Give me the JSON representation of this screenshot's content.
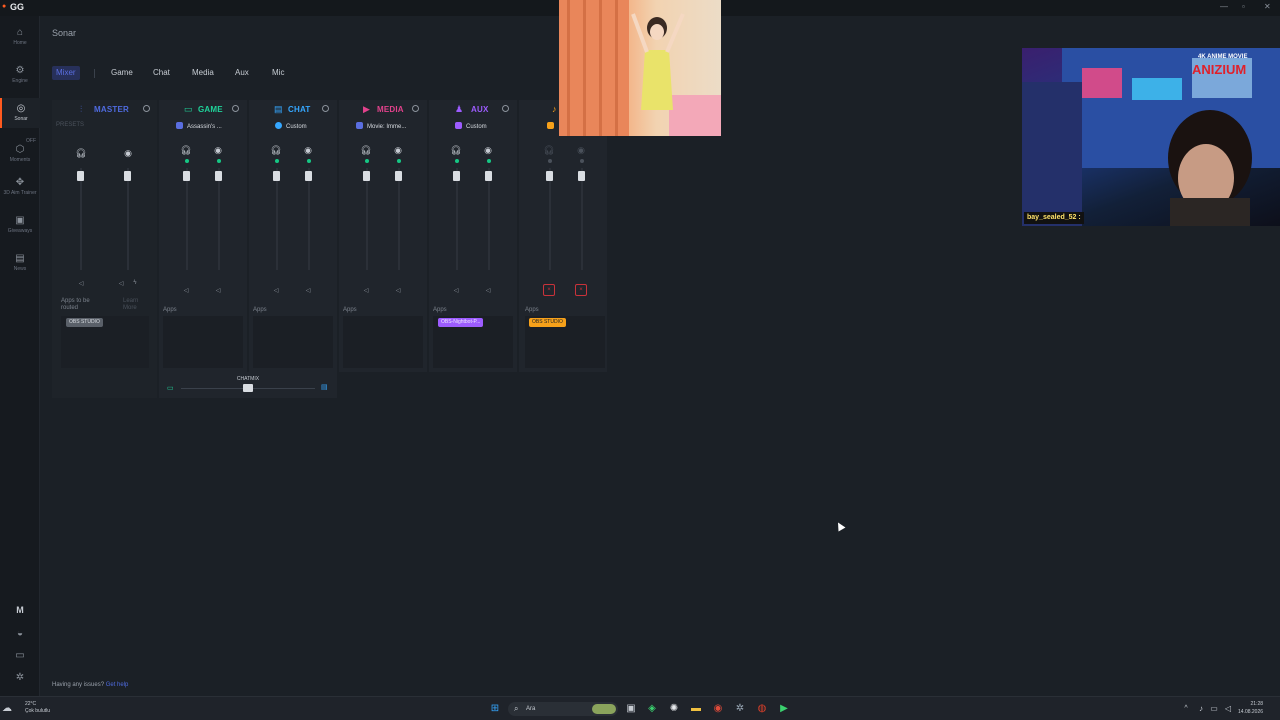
{
  "app": {
    "logo": "GG",
    "page_title": "Sonar"
  },
  "sidebar": {
    "items": [
      {
        "label": "Home",
        "icon": "home-icon"
      },
      {
        "label": "Engine",
        "icon": "engine-icon"
      },
      {
        "label": "Sonar",
        "icon": "sonar-icon"
      },
      {
        "label": "Moments",
        "icon": "moments-icon",
        "badge": "OFF"
      },
      {
        "label": "3D Aim Trainer",
        "icon": "aim-trainer-icon"
      },
      {
        "label": "Giveaways",
        "icon": "gift-icon"
      },
      {
        "label": "News",
        "icon": "news-icon"
      }
    ],
    "bottom": {
      "avatar": "M"
    }
  },
  "tabs": [
    "Mixer",
    "Game",
    "Chat",
    "Media",
    "Aux",
    "Mic"
  ],
  "mixer": {
    "master": {
      "title": "MASTER",
      "preset": "PRESETS",
      "apps_label": "Apps to be routed",
      "learn_more": "Learn More",
      "chip": "OBS STUDIO"
    },
    "channels": [
      {
        "key": "game",
        "title": "GAME",
        "preset": "Assassin's ...",
        "apps_label": "Apps",
        "color": "#1fd39a"
      },
      {
        "key": "chat",
        "title": "CHAT",
        "preset": "Custom",
        "apps_label": "Apps",
        "color": "#35a7ff"
      },
      {
        "key": "media",
        "title": "MEDIA",
        "preset": "Movie: Imme...",
        "apps_label": "Apps",
        "color": "#e2428c"
      },
      {
        "key": "aux",
        "title": "AUX",
        "preset": "Custom",
        "apps_label": "Apps",
        "color": "#9d5cff",
        "chip": "OBS-Nightbot-P..."
      },
      {
        "key": "mic",
        "title": "",
        "preset": "",
        "apps_label": "Apps",
        "color": "#f7a11a",
        "chip": "OBS STUDIO"
      }
    ],
    "chatmix": {
      "label": "CHATMIX",
      "level": 0.5
    }
  },
  "overlay": {
    "cam_user": "bay_sealed_52 :",
    "cam_banner": "4K ANIME MOVIE",
    "cam_brand": "ANIZIUM"
  },
  "footer": {
    "help_text": "Having any issues?",
    "help_link": "Get help"
  },
  "taskbar": {
    "search_placeholder": "Ara",
    "weather_temp": "22°C",
    "weather_desc": "Çok bulutlu",
    "time": "21:28",
    "date": "14.08.2026"
  },
  "colors": {
    "master": "#4f6be0",
    "accent_orange": "#ff5a1f",
    "led_green": "#16c784"
  }
}
